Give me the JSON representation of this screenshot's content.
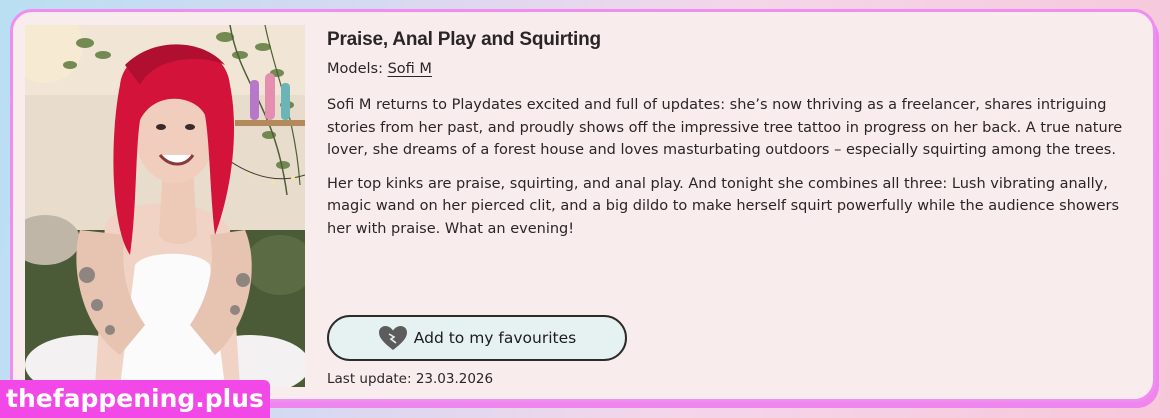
{
  "video": {
    "title": "Praise, Anal Play and Squirting",
    "models_label": "Models:",
    "model_name": "Sofi M",
    "description_1": "Sofi M returns to Playdates excited and full of updates: she’s now thriving as a freelancer, shares intriguing stories from her past, and proudly shows off the impressive tree tattoo in progress on her back. A true nature lover, she dreams of a forest house and loves masturbating outdoors – especially squirting among the trees.",
    "description_2": "Her top kinks are praise, squirting, and anal play. And tonight she combines all three: Lush vibrating anally, magic wand on her pierced clit, and a big dildo to make herself squirt powerfully while the audience showers her with praise. What an evening!",
    "favourite_button_label": "Add to my favourites",
    "last_update": "Last update: 23.03.2026"
  },
  "watermark": "thefappening.plus",
  "icons": {
    "favourite": "heart-icon"
  },
  "colors": {
    "card_background": "#f9eced",
    "card_border": "#f08ef0",
    "button_background": "#e6f2f1",
    "watermark_background": "#f248e7"
  }
}
